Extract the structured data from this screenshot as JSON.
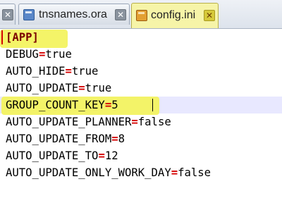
{
  "tabs": [
    {
      "label": "",
      "icon": "close-icon",
      "active": false
    },
    {
      "label": "tnsnames.ora",
      "icon": "file-icon",
      "active": false
    },
    {
      "label": "config.ini",
      "icon": "file-icon",
      "active": true
    }
  ],
  "close_glyph": "✕",
  "editor": {
    "lines": [
      {
        "section": "[APP]"
      },
      {
        "key": "DEBUG",
        "eq": "=",
        "value": "true"
      },
      {
        "key": "AUTO_HIDE",
        "eq": "=",
        "value": "true"
      },
      {
        "key": "AUTO_UPDATE",
        "eq": "=",
        "value": "true"
      },
      {
        "key": "GROUP_COUNT_KEY",
        "eq": "=",
        "value": "5"
      },
      {
        "key": "AUTO_UPDATE_PLANNER",
        "eq": "=",
        "value": "false"
      },
      {
        "key": "AUTO_UPDATE_FROM",
        "eq": "=",
        "value": "8"
      },
      {
        "key": "AUTO_UPDATE_TO",
        "eq": "=",
        "value": "12"
      },
      {
        "key": "AUTO_UPDATE_ONLY_WORK_DAY",
        "eq": "=",
        "value": "false"
      }
    ]
  },
  "colors": {
    "highlight": "#f3f360",
    "equals": "#d40000",
    "section": "#7a0000",
    "current_line": "#e8e8ff"
  }
}
